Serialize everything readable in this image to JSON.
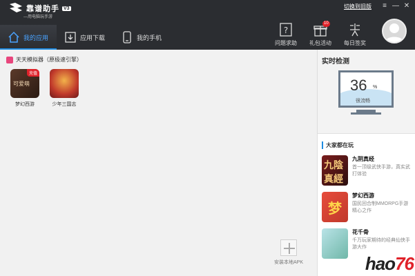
{
  "app": {
    "title": "靠谱助手",
    "subtitle": "—用电脑玩手游",
    "version": "V3",
    "top_link": "切换到旧版"
  },
  "window_controls": [
    "≡",
    "—",
    "✕"
  ],
  "tabs": [
    {
      "label": "我的应用",
      "icon": "home-icon"
    },
    {
      "label": "应用下载",
      "icon": "download-icon"
    },
    {
      "label": "我的手机",
      "icon": "phone-icon"
    }
  ],
  "tools": [
    {
      "label": "问题求助",
      "icon": "help-icon"
    },
    {
      "label": "礼包活动",
      "icon": "gift-icon",
      "badge": "10"
    },
    {
      "label": "每日签奖",
      "icon": "award-icon"
    }
  ],
  "section": {
    "title": "天天模拟器（原极速引擎）"
  },
  "games": [
    {
      "name": "梦幻西游",
      "tag": "充值",
      "icon_text": "可爱萌"
    },
    {
      "name": "少年三国志"
    }
  ],
  "install_apk": "安装本地APK",
  "detect": {
    "title": "实时检测",
    "value": "36",
    "unit": "%",
    "status": "很流畅"
  },
  "popular": {
    "title": "大家都在玩",
    "items": [
      {
        "name": "九阴真经",
        "desc": "首一顶级武侠手游，真实武打体验",
        "icon_text": "九陰真經"
      },
      {
        "name": "梦幻西游",
        "desc": "国民回合制MMORPG手游精心之作",
        "icon_text": "梦"
      },
      {
        "name": "花千骨",
        "desc": "千万玩家期待的经典仙侠手游大作"
      }
    ]
  },
  "watermark": {
    "text": "hao",
    "num": "76"
  }
}
